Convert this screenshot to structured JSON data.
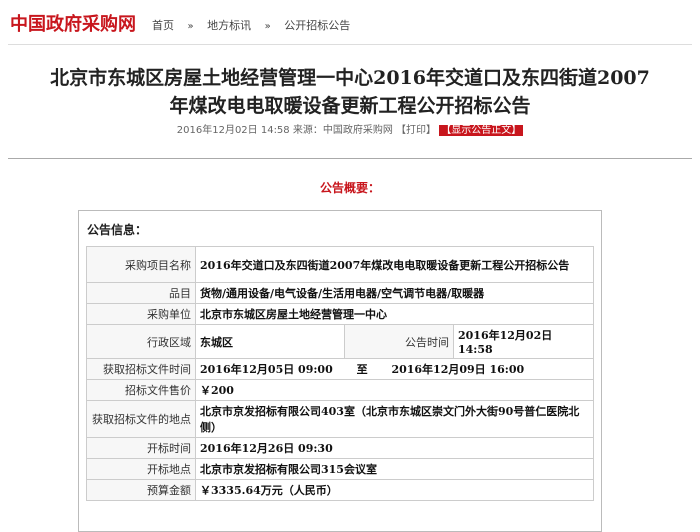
{
  "site": {
    "logo_text": "中国政府采购网"
  },
  "breadcrumb": {
    "items": [
      "首页",
      "地方标讯",
      "公开招标公告"
    ],
    "separator": "»"
  },
  "article": {
    "title_line1": "北京市东城区房屋土地经营管理一中心2016年交道口及东四街道2007",
    "title_line2": "年煤改电电取暖设备更新工程公开招标公告",
    "date": "2016年12月02日 14:58",
    "source": "来源：中国政府采购网",
    "print_label": "【打印】",
    "show_notice_label": "【显示公告正文】"
  },
  "summary": {
    "section_title": "公告概要：",
    "info_header": "公告信息：",
    "rows": [
      {
        "label": "采购项目名称",
        "value": "2016年交道口及东四街道2007年煤改电电取暖设备更新工程公开招标公告"
      },
      {
        "label": "品目",
        "value": "货物/通用设备/电气设备/生活用电器/空气调节电器/取暖器"
      },
      {
        "label": "采购单位",
        "value": "北京市东城区房屋土地经营管理一中心"
      },
      {
        "label": "行政区域",
        "value": "东城区",
        "label2": "公告时间",
        "value2": "2016年12月02日  14:58"
      },
      {
        "label": "获取招标文件时间",
        "value_from": "2016年12月05日  09:00",
        "to": "至",
        "value_to": "2016年12月09日  16:00"
      },
      {
        "label": "招标文件售价",
        "value": "￥200"
      },
      {
        "label": "获取招标文件的地点",
        "value": "北京市京发招标有限公司403室（北京市东城区崇文门外大街90号普仁医院北侧）"
      },
      {
        "label": "开标时间",
        "value": "2016年12月26日  09:30"
      },
      {
        "label": "开标地点",
        "value": "北京市京发招标有限公司315会议室"
      },
      {
        "label": "预算金额",
        "value": "￥3335.64万元（人民币）"
      }
    ]
  },
  "colors": {
    "brand_red": "#c8161d"
  }
}
